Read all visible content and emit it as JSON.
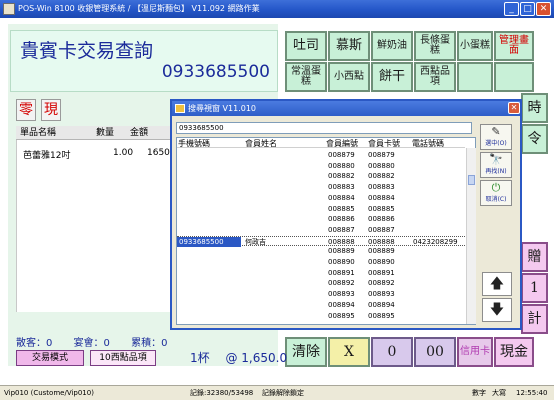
{
  "window": {
    "title": "POS-Win 8100 收銀管理系統 / 【溫尼斯麵包】 V11.092 網路作業",
    "min": "_",
    "max": "□",
    "close": "✕"
  },
  "query": {
    "title": "貴賓卡交易查詢",
    "phone": "0933685500"
  },
  "mode_buttons": {
    "zero": "零",
    "cash": "現"
  },
  "list": {
    "headers": [
      "單品名稱",
      "數量",
      "金額"
    ],
    "rows": [
      {
        "name": "芭蕾雅12吋",
        "qty": "1.00",
        "amount": "1650.0"
      }
    ]
  },
  "keypad": {
    "row1": [
      "吐司",
      "慕斯",
      "鮮奶油",
      "長條蛋糕",
      "小蛋糕",
      "管理畫面"
    ],
    "row2": [
      "常溫蛋糕",
      "小西點",
      "餅干",
      "西點品項",
      "",
      ""
    ],
    "side_labels": [
      "時",
      "令",
      "贈",
      "1",
      "合",
      "計"
    ],
    "bottom": [
      "清除",
      "X",
      "0",
      "00",
      "信用卡",
      "現金"
    ]
  },
  "stats": {
    "guest": "散客：0",
    "banquet": "宴會：0",
    "points": "累積：0"
  },
  "buttons": {
    "trade_mode": "交易模式",
    "west_items": "10西點品項"
  },
  "totals": {
    "count": "1杯",
    "amount": "@ 1,650.0"
  },
  "status": {
    "user": "Vip010 (Custome/Vip010)",
    "records": "記錄:32380/53498",
    "unlock": "記錄解除鎖定",
    "numlock": "數字",
    "caps": "大寫",
    "time": "12:55:40"
  },
  "dialog": {
    "title": "搜尋視窗 V11.010",
    "search": "0933685500",
    "columns": [
      "手機號碼",
      "會員姓名",
      "會員編號",
      "會員卡號",
      "電話號碼"
    ],
    "rows": [
      {
        "mobile": "",
        "name": "",
        "id": "008879",
        "card": "008879",
        "tel": ""
      },
      {
        "mobile": "",
        "name": "",
        "id": "008880",
        "card": "008880",
        "tel": ""
      },
      {
        "mobile": "",
        "name": "",
        "id": "008882",
        "card": "008882",
        "tel": ""
      },
      {
        "mobile": "",
        "name": "",
        "id": "008883",
        "card": "008883",
        "tel": ""
      },
      {
        "mobile": "",
        "name": "",
        "id": "008884",
        "card": "008884",
        "tel": ""
      },
      {
        "mobile": "",
        "name": "",
        "id": "008885",
        "card": "008885",
        "tel": ""
      },
      {
        "mobile": "",
        "name": "",
        "id": "008886",
        "card": "008886",
        "tel": ""
      },
      {
        "mobile": "",
        "name": "",
        "id": "008887",
        "card": "008887",
        "tel": ""
      },
      {
        "mobile": "0933685500",
        "name": "何政吉",
        "id": "008888",
        "card": "008888",
        "tel": "0423208299"
      },
      {
        "mobile": "",
        "name": "",
        "id": "008889",
        "card": "008889",
        "tel": ""
      },
      {
        "mobile": "",
        "name": "",
        "id": "008890",
        "card": "008890",
        "tel": ""
      },
      {
        "mobile": "",
        "name": "",
        "id": "008891",
        "card": "008891",
        "tel": ""
      },
      {
        "mobile": "",
        "name": "",
        "id": "008892",
        "card": "008892",
        "tel": ""
      },
      {
        "mobile": "",
        "name": "",
        "id": "008893",
        "card": "008893",
        "tel": ""
      },
      {
        "mobile": "",
        "name": "",
        "id": "008894",
        "card": "008894",
        "tel": ""
      },
      {
        "mobile": "",
        "name": "",
        "id": "008895",
        "card": "008895",
        "tel": ""
      }
    ],
    "side": [
      {
        "icon": "✎",
        "label": "選中(O)"
      },
      {
        "icon": "🔭",
        "label": "再找(N)"
      },
      {
        "icon": "⏻",
        "label": "取消(C)"
      }
    ],
    "arrows": [
      "🡅",
      "🡇"
    ]
  }
}
